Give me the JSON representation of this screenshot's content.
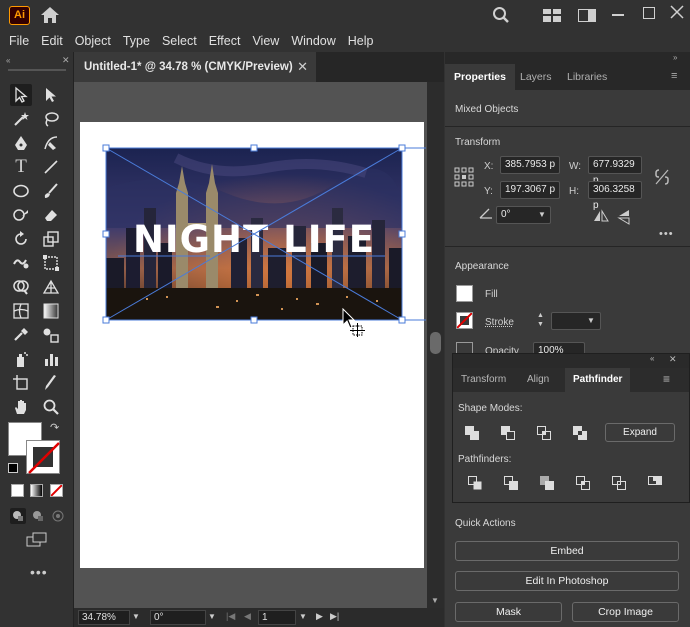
{
  "app": {
    "logo": "Ai"
  },
  "menu": [
    "File",
    "Edit",
    "Object",
    "Type",
    "Select",
    "Effect",
    "View",
    "Window",
    "Help"
  ],
  "document": {
    "tab_title": "Untitled-1* @ 34.78 % (CMYK/Preview)"
  },
  "artwork": {
    "headline": "NIGHT LIFE"
  },
  "status": {
    "zoom": "34.78%",
    "rotation": "0°",
    "artboard": "1"
  },
  "panel": {
    "tabs": [
      "Properties",
      "Layers",
      "Libraries"
    ],
    "selection": "Mixed Objects",
    "transform": {
      "title": "Transform",
      "x_label": "X:",
      "x": "385.7953 p",
      "y_label": "Y:",
      "y": "197.3067 p",
      "w_label": "W:",
      "w": "677.9329 p",
      "h_label": "H:",
      "h": "306.3258 p",
      "angle": "0°"
    },
    "appearance": {
      "title": "Appearance",
      "fill_label": "Fill",
      "stroke_label": "Stroke",
      "opacity_label": "Opacity",
      "opacity": "100%"
    },
    "quick_actions": {
      "title": "Quick Actions",
      "embed": "Embed",
      "edit_in_photoshop": "Edit In Photoshop",
      "mask": "Mask",
      "crop_image": "Crop Image"
    }
  },
  "pathfinder_panel": {
    "tabs": [
      "Transform",
      "Align",
      "Pathfinder"
    ],
    "shape_modes_label": "Shape Modes:",
    "expand_label": "Expand",
    "pathfinders_label": "Pathfinders:"
  },
  "colors": {
    "accent": "#ff9a00",
    "selection": "#4a7bd9"
  }
}
